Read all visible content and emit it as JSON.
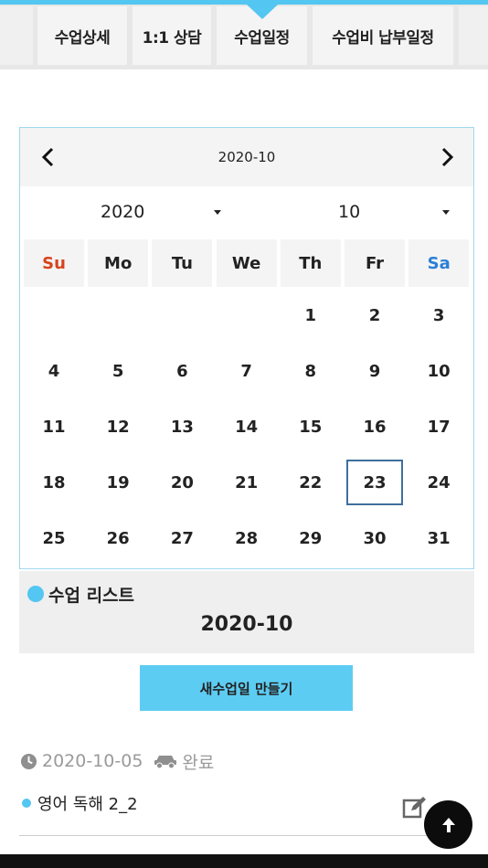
{
  "tabs": [
    {
      "label": "수업상세"
    },
    {
      "label": "1:1 상담"
    },
    {
      "label": "수업일정"
    },
    {
      "label": "수업비 납부일정"
    }
  ],
  "calendar": {
    "title": "2020-10",
    "year_value": "2020",
    "month_value": "10",
    "weekdays": [
      "Su",
      "Mo",
      "Tu",
      "We",
      "Th",
      "Fr",
      "Sa"
    ],
    "days": [
      "1",
      "2",
      "3",
      "4",
      "5",
      "6",
      "7",
      "8",
      "9",
      "10",
      "11",
      "12",
      "13",
      "14",
      "15",
      "16",
      "17",
      "18",
      "19",
      "20",
      "21",
      "22",
      "23",
      "24",
      "25",
      "26",
      "27",
      "28",
      "29",
      "30",
      "31"
    ],
    "first_weekday_index": 4,
    "today": "23",
    "colors": {
      "sunday": "#d8441e",
      "saturday": "#2b7fd6",
      "accent": "#53c6f1"
    },
    "icons": {
      "prev": "chevron-left-icon",
      "next": "chevron-right-icon",
      "dropdown": "caret-down-icon"
    }
  },
  "list": {
    "label": "수업 리스트",
    "month": "2020-10",
    "new_button_label": "새수업일 만들기"
  },
  "lesson": {
    "date": "2020-10-05",
    "status": "완료",
    "title": "영어 독해 2_2",
    "icons": {
      "date": "clock-icon",
      "status": "car-icon",
      "edit": "edit-icon",
      "scroll_top": "arrow-up-icon"
    }
  }
}
